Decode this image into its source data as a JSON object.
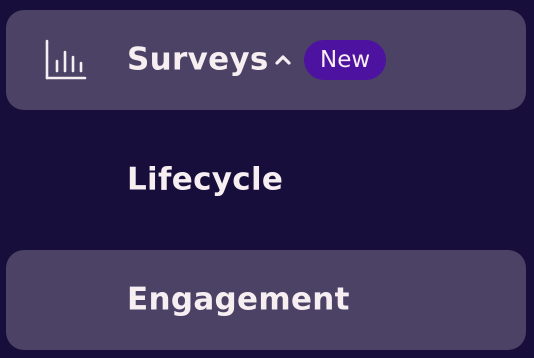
{
  "nav": {
    "items": [
      {
        "label": "Surveys",
        "icon": "bar-chart-icon",
        "expanded": true,
        "badge": "New",
        "highlighted": true
      },
      {
        "label": "Lifecycle",
        "highlighted": false
      },
      {
        "label": "Engagement",
        "highlighted": true
      }
    ]
  },
  "colors": {
    "background": "#170e3b",
    "row_highlight": "#4b4266",
    "text": "#f6eef0",
    "badge_bg": "#4d12a0"
  }
}
